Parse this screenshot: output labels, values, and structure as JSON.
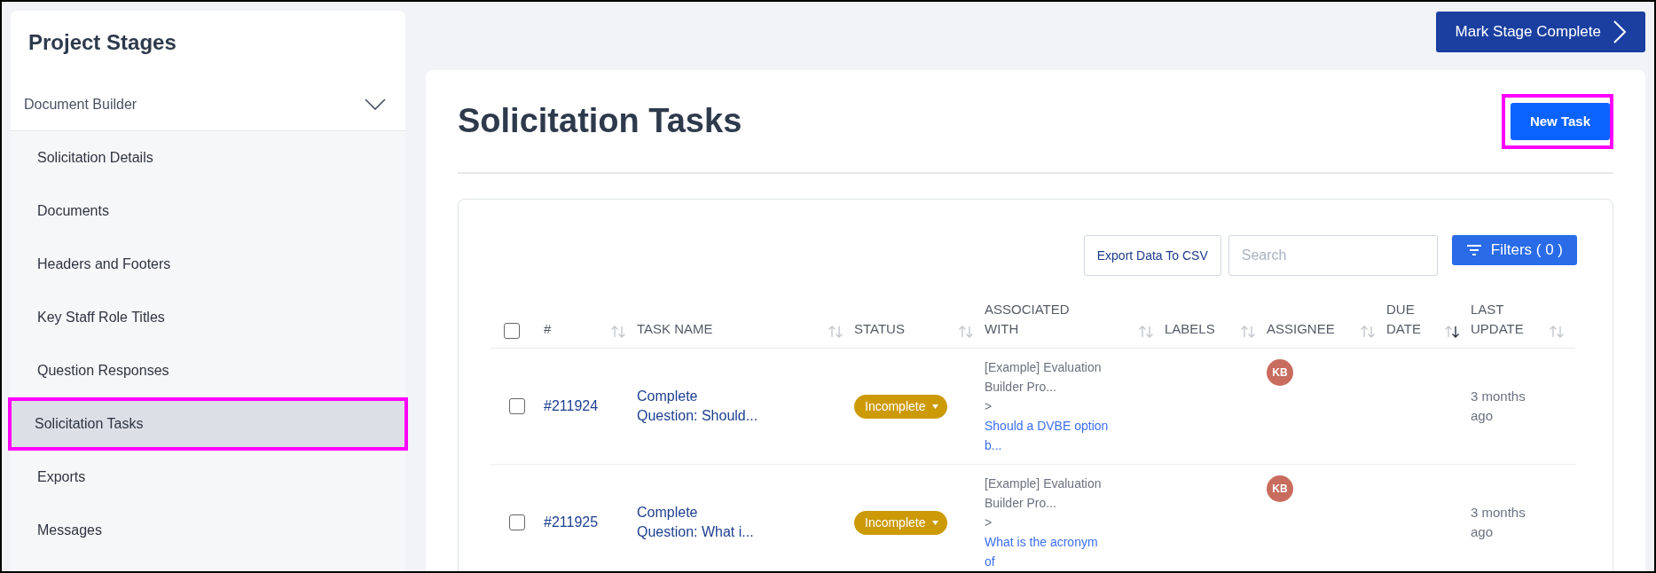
{
  "sidebar": {
    "title": "Project Stages",
    "section": {
      "label": "Document Builder",
      "expanded": true
    },
    "items": [
      {
        "label": "Solicitation Details",
        "selected": false
      },
      {
        "label": "Documents",
        "selected": false
      },
      {
        "label": "Headers and Footers",
        "selected": false
      },
      {
        "label": "Key Staff Role Titles",
        "selected": false
      },
      {
        "label": "Question Responses",
        "selected": false
      },
      {
        "label": "Solicitation Tasks",
        "selected": true
      },
      {
        "label": "Exports",
        "selected": false
      },
      {
        "label": "Messages",
        "selected": false
      }
    ]
  },
  "top_button": "Mark Stage Complete",
  "page": {
    "title": "Solicitation Tasks",
    "new_task_button": "New Task"
  },
  "toolbar": {
    "export_button": "Export Data To CSV",
    "search": {
      "placeholder": "Search"
    },
    "filters_button": "Filters ( 0 )"
  },
  "table": {
    "select_all_checked": false,
    "columns": [
      {
        "label": "#",
        "sort_active": false
      },
      {
        "label": "TASK NAME",
        "sort_active": false
      },
      {
        "label": "STATUS",
        "sort_active": false
      },
      {
        "label": "ASSOCIATED\nWITH",
        "sort_active": false
      },
      {
        "label": "LABELS",
        "sort_active": false
      },
      {
        "label": "ASSIGNEE",
        "sort_active": false
      },
      {
        "label": "DUE\nDATE",
        "sort_active": true
      },
      {
        "label": "LAST\nUPDATE",
        "sort_active": false
      }
    ],
    "rows": [
      {
        "checked": false,
        "id": "#211924",
        "task_name": "Complete\nQuestion: Should...",
        "status": "Incomplete",
        "associated_with": "[Example] Evaluation\nBuilder Pro...\n>",
        "associated_link": "Should a DVBE option\nb...",
        "assignee": "KB",
        "last_update": "3 months\nago"
      },
      {
        "checked": false,
        "id": "#211925",
        "task_name": "Complete\nQuestion: What i...",
        "status": "Incomplete",
        "associated_with": "[Example] Evaluation\nBuilder Pro...\n>",
        "associated_link": "What is the acronym\nof",
        "assignee": "KB",
        "last_update": "3 months\nago"
      }
    ]
  }
}
